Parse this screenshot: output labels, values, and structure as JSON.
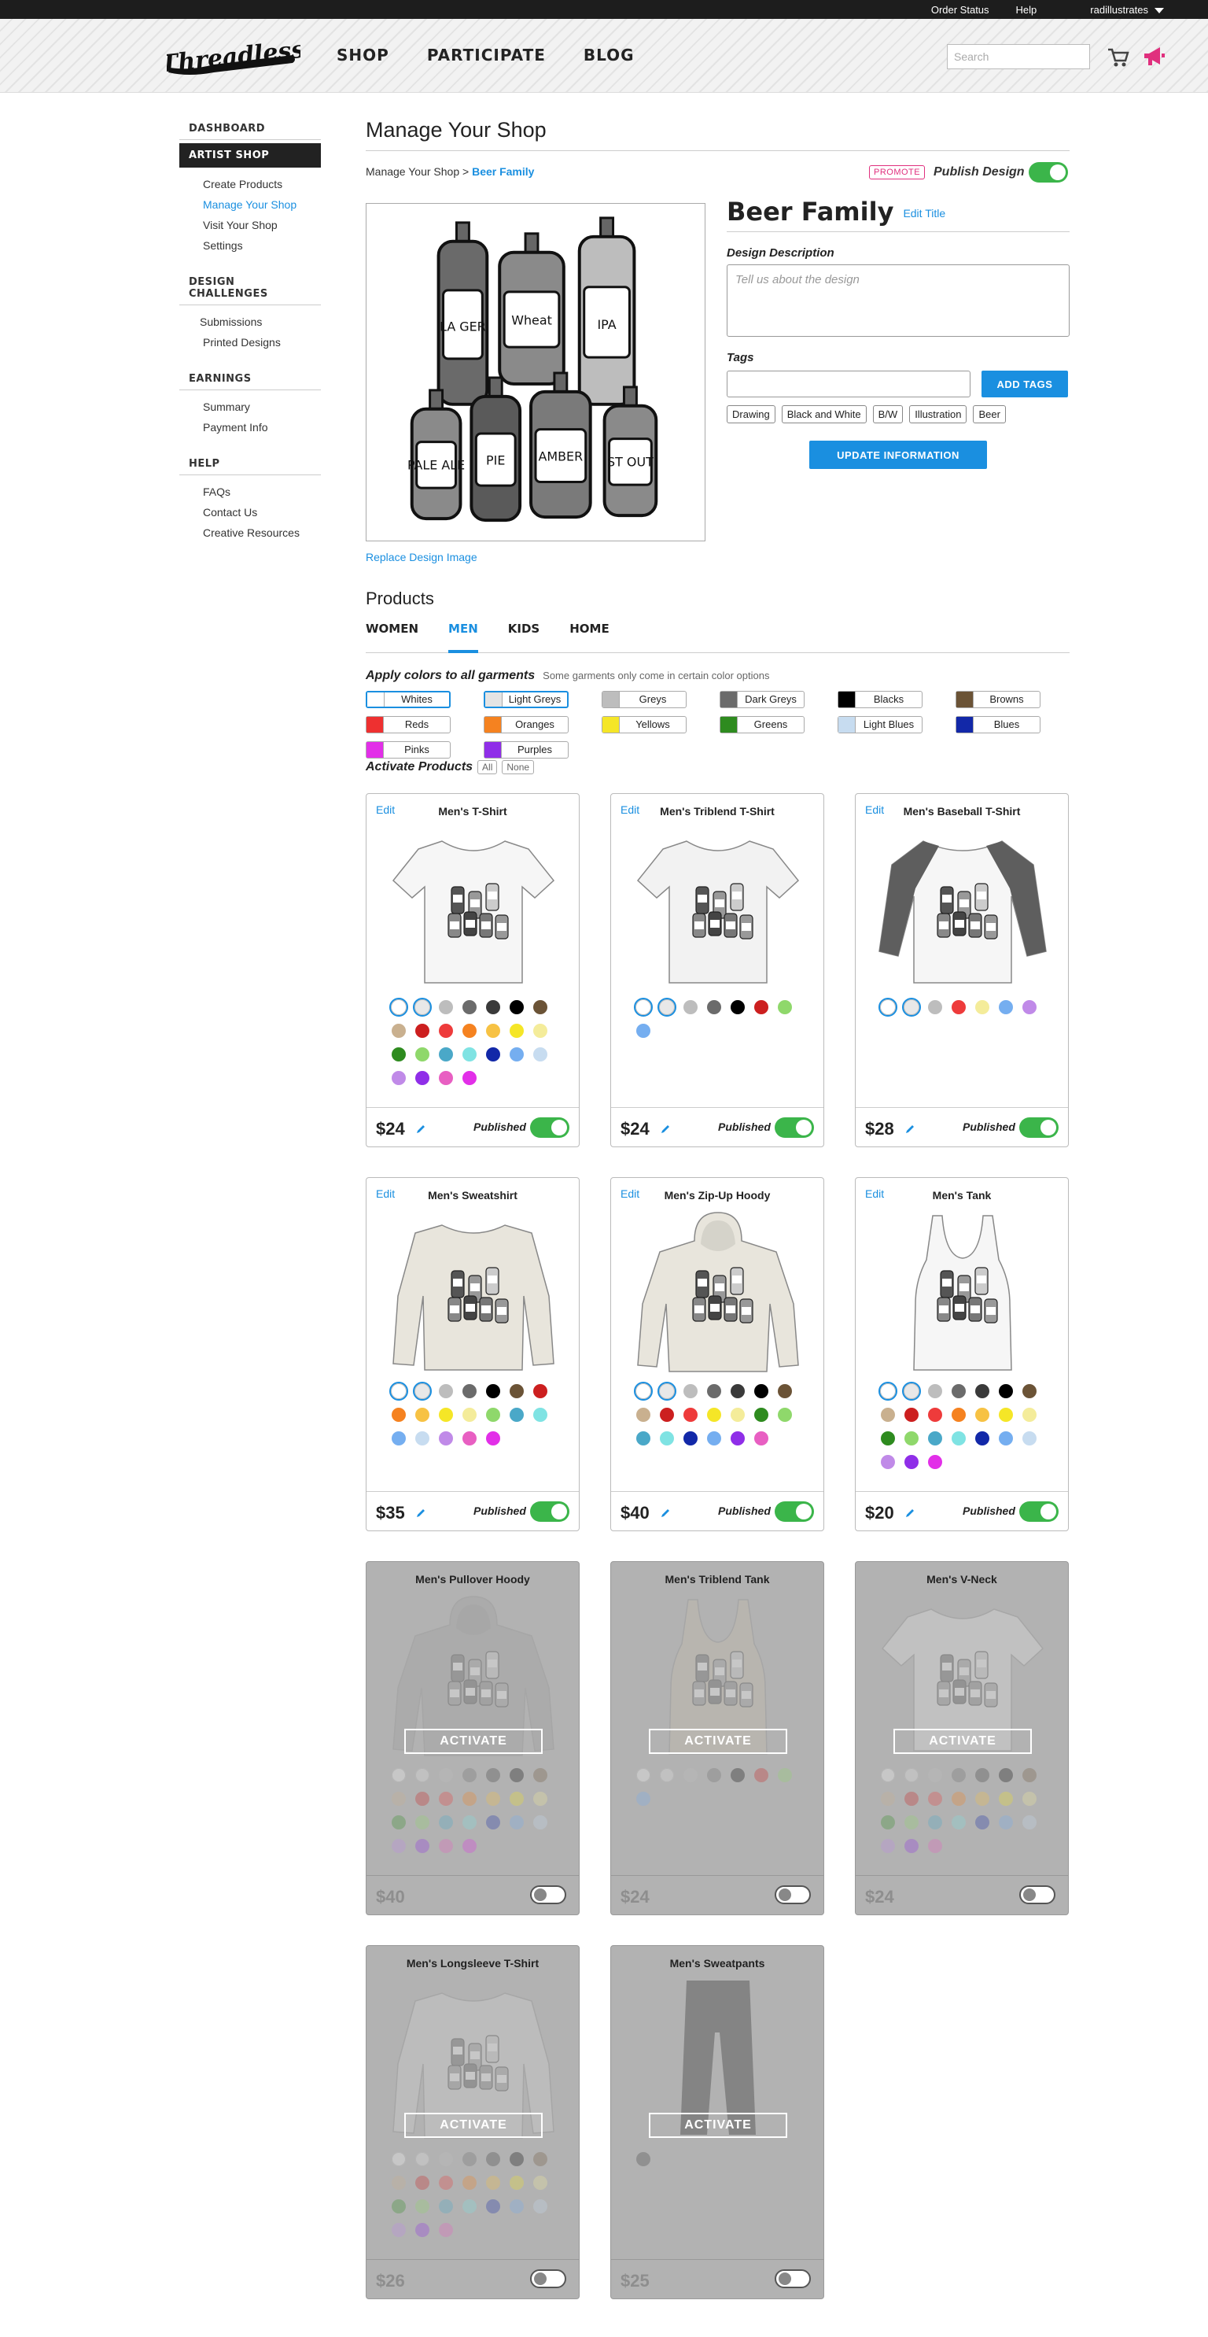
{
  "topbar": {
    "order_status": "Order Status",
    "help": "Help",
    "user": "radillustrates"
  },
  "header": {
    "logo_text": "Threadless",
    "nav": [
      "SHOP",
      "PARTICIPATE",
      "BLOG"
    ],
    "search_placeholder": "Search"
  },
  "sidebar": {
    "dashboard": "DASHBOARD",
    "artist_shop": "ARTIST SHOP",
    "artist_items": [
      "Create Products",
      "Manage Your Shop",
      "Visit Your Shop",
      "Settings"
    ],
    "challenges": "DESIGN CHALLENGES",
    "challenge_items": [
      "Submissions",
      "Printed Designs"
    ],
    "earnings": "EARNINGS",
    "earnings_items": [
      "Summary",
      "Payment Info"
    ],
    "help": "HELP",
    "help_items": [
      "FAQs",
      "Contact Us",
      "Creative Resources"
    ]
  },
  "main": {
    "title": "Manage Your Shop",
    "crumb_root": "Manage Your Shop",
    "crumb_sep": " > ",
    "crumb_current": "Beer Family",
    "promote": "PROMOTE",
    "publish_design": "Publish Design",
    "replace_image": "Replace Design Image",
    "design_title": "Beer Family",
    "edit_title": "Edit Title",
    "desc_label": "Design Description",
    "desc_placeholder": "Tell us about the design",
    "tags_label": "Tags",
    "add_tags": "ADD TAGS",
    "tags": [
      "Drawing",
      "Black and White",
      "B/W",
      "Illustration",
      "Beer"
    ],
    "update": "UPDATE INFORMATION",
    "bottle_labels": [
      "LA GER",
      "Wheat",
      "IPA",
      "PALE ALE",
      "PIE",
      "AMBER",
      "ST OUT"
    ]
  },
  "products": {
    "heading": "Products",
    "tabs": [
      "WOMEN",
      "MEN",
      "KIDS",
      "HOME"
    ],
    "active_tab": "MEN",
    "apply_label": "Apply colors to all garments",
    "apply_note": "Some garments only come in certain color options",
    "color_buttons": [
      {
        "label": "Whites",
        "color": "#ffffff",
        "selected": true
      },
      {
        "label": "Light Greys",
        "color": "#e4e4e4",
        "selected": true
      },
      {
        "label": "Greys",
        "color": "#bdbdbd",
        "selected": false
      },
      {
        "label": "Dark Greys",
        "color": "#6b6b6b",
        "selected": false
      },
      {
        "label": "Blacks",
        "color": "#000000",
        "selected": false
      },
      {
        "label": "Browns",
        "color": "#6b5336",
        "selected": false
      },
      {
        "label": "Reds",
        "color": "#ee3030",
        "selected": false
      },
      {
        "label": "Oranges",
        "color": "#f58220",
        "selected": false
      },
      {
        "label": "Yellows",
        "color": "#f5e627",
        "selected": false
      },
      {
        "label": "Greens",
        "color": "#2e8b1f",
        "selected": false
      },
      {
        "label": "Light Blues",
        "color": "#c7dcf0",
        "selected": false
      },
      {
        "label": "Blues",
        "color": "#1228a8",
        "selected": false
      },
      {
        "label": "Pinks",
        "color": "#e22fe8",
        "selected": false
      },
      {
        "label": "Purples",
        "color": "#8f2ee8",
        "selected": false
      }
    ],
    "activate_label": "Activate Products",
    "all": "All",
    "none": "None",
    "published_label": "Published",
    "edit_label": "Edit",
    "activate_button": "ACTIVATE",
    "cards": [
      {
        "name": "Men's T-Shirt",
        "price": "$24",
        "active": true,
        "garment": "tee",
        "body": "#f6f6f6",
        "sleeve": "#f6f6f6",
        "swatches": [
          "#ffffff",
          "#e8e8e8",
          "#bdbdbd",
          "#6b6b6b",
          "#3a3a3a",
          "#000000",
          "#6b5336",
          "#c9b08f",
          "#cc1f1f",
          "#ee3b3b",
          "#f58220",
          "#f7c244",
          "#f5e627",
          "#f4ec9a",
          "#2e8b1f",
          "#8fd86b",
          "#4aa8c8",
          "#7fe3e3",
          "#1228a8",
          "#75aef0",
          "#c7dcf0",
          "#c08ae8",
          "#8f2ee8",
          "#e85fc2",
          "#e22fe8"
        ]
      },
      {
        "name": "Men's Triblend T-Shirt",
        "price": "$24",
        "active": true,
        "garment": "tee",
        "body": "#f2f2f2",
        "sleeve": "#f2f2f2",
        "swatches": [
          "#ffffff",
          "#e8e8e8",
          "#bdbdbd",
          "#6b6b6b",
          "#000000",
          "#cc1f1f",
          "#8fd86b",
          "#75aef0"
        ]
      },
      {
        "name": "Men's Baseball T-Shirt",
        "price": "$28",
        "active": true,
        "garment": "raglan",
        "body": "#f6f6f6",
        "sleeve": "#5e5e5e",
        "swatches": [
          "#ffffff",
          "#e8e8e8",
          "#bdbdbd",
          "#ee3b3b",
          "#f4ec9a",
          "#75aef0",
          "#c08ae8"
        ]
      },
      {
        "name": "Men's Sweatshirt",
        "price": "$35",
        "active": true,
        "garment": "sweatshirt",
        "body": "#e8e5dc",
        "sleeve": "#e8e5dc",
        "swatches": [
          "#ffffff",
          "#e8e8e8",
          "#bdbdbd",
          "#6b6b6b",
          "#000000",
          "#6b5336",
          "#cc1f1f",
          "#f58220",
          "#f7c244",
          "#f5e627",
          "#f4ec9a",
          "#8fd86b",
          "#4aa8c8",
          "#7fe3e3",
          "#75aef0",
          "#c7dcf0",
          "#c08ae8",
          "#e85fc2",
          "#e22fe8"
        ]
      },
      {
        "name": "Men's Zip-Up Hoody",
        "price": "$40",
        "active": true,
        "garment": "hoody",
        "body": "#e8e5dc",
        "sleeve": "#e8e5dc",
        "swatches": [
          "#ffffff",
          "#e8e8e8",
          "#bdbdbd",
          "#6b6b6b",
          "#3a3a3a",
          "#000000",
          "#6b5336",
          "#c9b08f",
          "#cc1f1f",
          "#ee3b3b",
          "#f5e627",
          "#f4ec9a",
          "#2e8b1f",
          "#8fd86b",
          "#4aa8c8",
          "#7fe3e3",
          "#1228a8",
          "#75aef0",
          "#8f2ee8",
          "#e85fc2"
        ]
      },
      {
        "name": "Men's Tank",
        "price": "$20",
        "active": true,
        "garment": "tank",
        "body": "#f6f6f6",
        "sleeve": "#f6f6f6",
        "swatches": [
          "#ffffff",
          "#e8e8e8",
          "#bdbdbd",
          "#6b6b6b",
          "#3a3a3a",
          "#000000",
          "#6b5336",
          "#c9b08f",
          "#cc1f1f",
          "#ee3b3b",
          "#f58220",
          "#f7c244",
          "#f5e627",
          "#f4ec9a",
          "#2e8b1f",
          "#8fd86b",
          "#4aa8c8",
          "#7fe3e3",
          "#1228a8",
          "#75aef0",
          "#c7dcf0",
          "#c08ae8",
          "#8f2ee8",
          "#e22fe8"
        ]
      },
      {
        "name": "Men's Pullover Hoody",
        "price": "$40",
        "active": false,
        "garment": "hoody",
        "body": "#9a9a9a",
        "sleeve": "#9a9a9a",
        "swatches": [
          "#ffffff",
          "#e8e8e8",
          "#bdbdbd",
          "#6b6b6b",
          "#3a3a3a",
          "#000000",
          "#6b5336",
          "#c9b08f",
          "#cc1f1f",
          "#ee3b3b",
          "#f58220",
          "#f7c244",
          "#f5e627",
          "#f4ec9a",
          "#2e8b1f",
          "#8fd86b",
          "#4aa8c8",
          "#7fe3e3",
          "#1228a8",
          "#75aef0",
          "#c7dcf0",
          "#c08ae8",
          "#8f2ee8",
          "#e85fc2",
          "#e22fe8"
        ]
      },
      {
        "name": "Men's Triblend Tank",
        "price": "$24",
        "active": false,
        "garment": "tank",
        "body": "#c9bfa9",
        "sleeve": "#c9bfa9",
        "swatches": [
          "#ffffff",
          "#e8e8e8",
          "#bdbdbd",
          "#6b6b6b",
          "#000000",
          "#cc1f1f",
          "#8fd86b",
          "#75aef0"
        ]
      },
      {
        "name": "Men's V-Neck",
        "price": "$24",
        "active": false,
        "garment": "tee",
        "body": "#e8e8e8",
        "sleeve": "#e8e8e8",
        "swatches": [
          "#ffffff",
          "#e8e8e8",
          "#bdbdbd",
          "#6b6b6b",
          "#3a3a3a",
          "#000000",
          "#6b5336",
          "#c9b08f",
          "#cc1f1f",
          "#ee3b3b",
          "#f58220",
          "#f7c244",
          "#f5e627",
          "#f4ec9a",
          "#2e8b1f",
          "#8fd86b",
          "#4aa8c8",
          "#7fe3e3",
          "#1228a8",
          "#75aef0",
          "#c7dcf0",
          "#c08ae8",
          "#8f2ee8",
          "#e85fc2"
        ]
      },
      {
        "name": "Men's Longsleeve T-Shirt",
        "price": "$26",
        "active": false,
        "garment": "longsleeve",
        "body": "#d8d8d8",
        "sleeve": "#d8d8d8",
        "swatches": [
          "#ffffff",
          "#e8e8e8",
          "#bdbdbd",
          "#6b6b6b",
          "#3a3a3a",
          "#000000",
          "#6b5336",
          "#c9b08f",
          "#cc1f1f",
          "#ee3b3b",
          "#f58220",
          "#f7c244",
          "#f5e627",
          "#f4ec9a",
          "#2e8b1f",
          "#8fd86b",
          "#4aa8c8",
          "#7fe3e3",
          "#1228a8",
          "#75aef0",
          "#c7dcf0",
          "#c08ae8",
          "#8f2ee8",
          "#e85fc2"
        ]
      },
      {
        "name": "Men's Sweatpants",
        "price": "$25",
        "active": false,
        "garment": "pants",
        "body": "#111111",
        "sleeve": "#111111",
        "swatches": [
          "#3a3a3a"
        ]
      }
    ]
  }
}
